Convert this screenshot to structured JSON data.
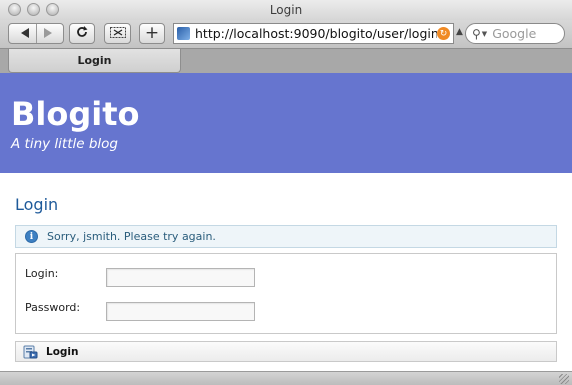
{
  "window": {
    "title": "Login"
  },
  "toolbar": {
    "address": "http://localhost:9090/blogito/user/login",
    "search_placeholder": "Google"
  },
  "tabs": [
    {
      "label": "Login"
    }
  ],
  "page": {
    "site_title": "Blogito",
    "tagline": "A tiny little blog",
    "heading": "Login",
    "notice": "Sorry, jsmith. Please try again.",
    "form": {
      "login_label": "Login:",
      "login_value": "",
      "password_label": "Password:",
      "password_value": "",
      "submit_label": "Login"
    }
  },
  "colors": {
    "header_bg": "#6675cf",
    "heading": "#1e5a9a",
    "notice_bg": "#eef5f9",
    "notice_text": "#2a5d7c"
  },
  "icons": [
    "back-icon",
    "forward-icon",
    "reload-icon",
    "snip-icon",
    "add-icon",
    "favicon-icon",
    "rss-icon",
    "search-icon",
    "info-icon",
    "submit-icon"
  ]
}
